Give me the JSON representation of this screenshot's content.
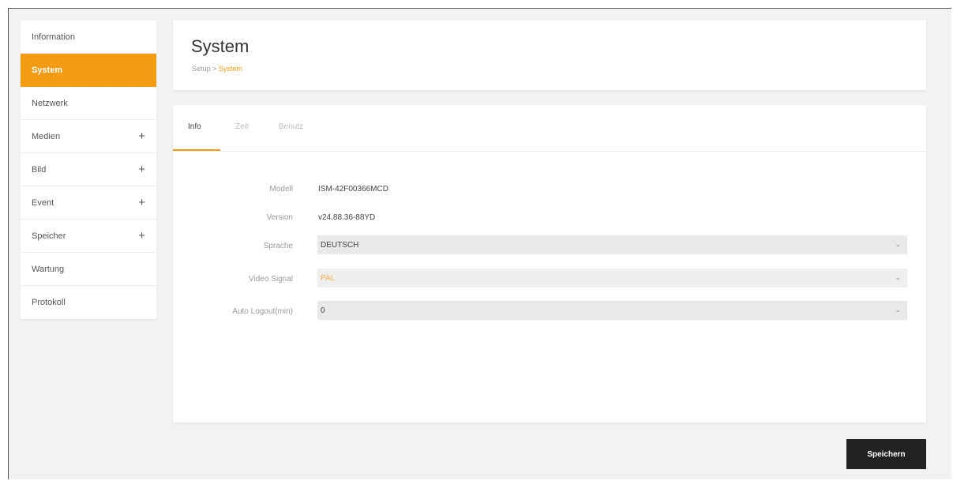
{
  "sidebar": {
    "items": [
      {
        "label": "Information",
        "expandable": false,
        "active": false
      },
      {
        "label": "System",
        "expandable": false,
        "active": true
      },
      {
        "label": "Netzwerk",
        "expandable": false,
        "active": false
      },
      {
        "label": "Medien",
        "expandable": true,
        "active": false
      },
      {
        "label": "Bild",
        "expandable": true,
        "active": false
      },
      {
        "label": "Event",
        "expandable": true,
        "active": false
      },
      {
        "label": "Speicher",
        "expandable": true,
        "active": false
      },
      {
        "label": "Wartung",
        "expandable": false,
        "active": false
      },
      {
        "label": "Protokoll",
        "expandable": false,
        "active": false
      }
    ],
    "expand_glyph": "+"
  },
  "header": {
    "title": "System",
    "breadcrumb": {
      "root": "Setup",
      "separator": ">",
      "current": "System"
    }
  },
  "tabs": [
    {
      "label": "Info",
      "active": true
    },
    {
      "label": "Zeit",
      "active": false
    },
    {
      "label": "Benutz",
      "active": false
    }
  ],
  "form": {
    "model": {
      "label": "Modell",
      "value": "ISM-42F00366MCD"
    },
    "version": {
      "label": "Version",
      "value": "v24.88.36-88YD"
    },
    "language": {
      "label": "Sprache",
      "value": "DEUTSCH"
    },
    "video_signal": {
      "label": "Video Signal",
      "value": "PAL"
    },
    "auto_logout": {
      "label": "Auto Logout(min)",
      "value": "0"
    }
  },
  "buttons": {
    "save": "Speichern"
  },
  "colors": {
    "accent": "#f39c12",
    "button_dark": "#222222"
  }
}
